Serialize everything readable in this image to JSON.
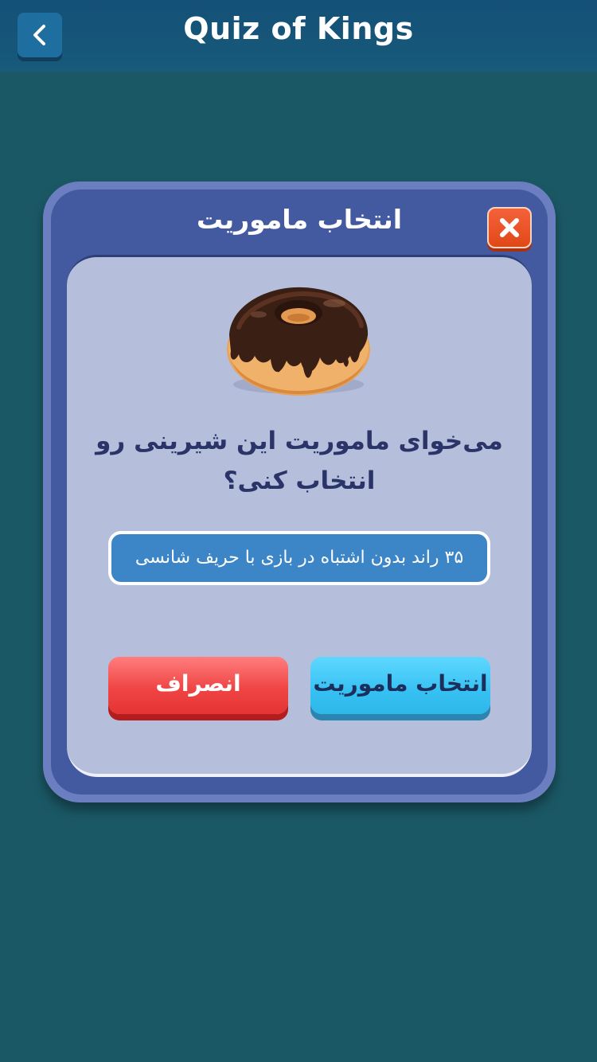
{
  "header": {
    "title": "Quiz of Kings",
    "back_icon": "chevron-left-icon"
  },
  "dialog": {
    "title": "انتخاب ماموریت",
    "close_icon": "close-icon",
    "image_icon": "donut-icon",
    "question_line1": "می‌خوای ماموریت این شیرینی رو",
    "question_line2": "انتخاب کنی؟",
    "mission_text": "۳۵ راند بدون اشتباه در بازی با حریف شانسی",
    "select_button_label": "انتخاب ماموریت",
    "cancel_button_label": "انصراف"
  },
  "colors": {
    "background": "#1b5866",
    "header": "#145078",
    "dialog_frame": "#445aa0",
    "panel": "#b5bedb",
    "select_button": "#36c1f2",
    "cancel_button": "#f04545",
    "close_button": "#e04818"
  }
}
